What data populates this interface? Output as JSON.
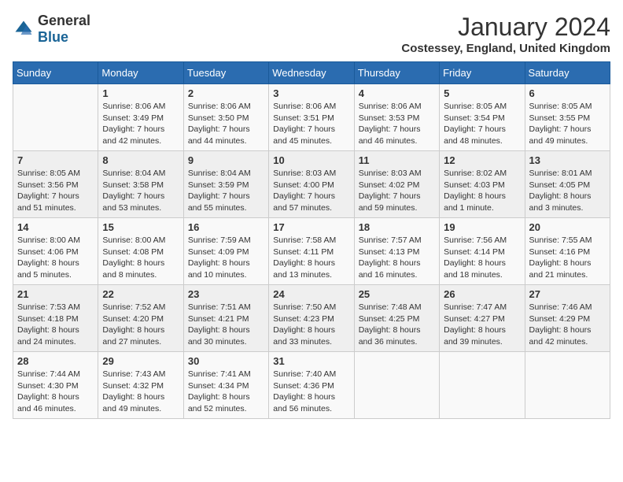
{
  "header": {
    "logo_general": "General",
    "logo_blue": "Blue",
    "title": "January 2024",
    "subtitle": "Costessey, England, United Kingdom"
  },
  "days_of_week": [
    "Sunday",
    "Monday",
    "Tuesday",
    "Wednesday",
    "Thursday",
    "Friday",
    "Saturday"
  ],
  "weeks": [
    [
      {
        "day": "",
        "sunrise": "",
        "sunset": "",
        "daylight": ""
      },
      {
        "day": "1",
        "sunrise": "Sunrise: 8:06 AM",
        "sunset": "Sunset: 3:49 PM",
        "daylight": "Daylight: 7 hours and 42 minutes."
      },
      {
        "day": "2",
        "sunrise": "Sunrise: 8:06 AM",
        "sunset": "Sunset: 3:50 PM",
        "daylight": "Daylight: 7 hours and 44 minutes."
      },
      {
        "day": "3",
        "sunrise": "Sunrise: 8:06 AM",
        "sunset": "Sunset: 3:51 PM",
        "daylight": "Daylight: 7 hours and 45 minutes."
      },
      {
        "day": "4",
        "sunrise": "Sunrise: 8:06 AM",
        "sunset": "Sunset: 3:53 PM",
        "daylight": "Daylight: 7 hours and 46 minutes."
      },
      {
        "day": "5",
        "sunrise": "Sunrise: 8:05 AM",
        "sunset": "Sunset: 3:54 PM",
        "daylight": "Daylight: 7 hours and 48 minutes."
      },
      {
        "day": "6",
        "sunrise": "Sunrise: 8:05 AM",
        "sunset": "Sunset: 3:55 PM",
        "daylight": "Daylight: 7 hours and 49 minutes."
      }
    ],
    [
      {
        "day": "7",
        "sunrise": "Sunrise: 8:05 AM",
        "sunset": "Sunset: 3:56 PM",
        "daylight": "Daylight: 7 hours and 51 minutes."
      },
      {
        "day": "8",
        "sunrise": "Sunrise: 8:04 AM",
        "sunset": "Sunset: 3:58 PM",
        "daylight": "Daylight: 7 hours and 53 minutes."
      },
      {
        "day": "9",
        "sunrise": "Sunrise: 8:04 AM",
        "sunset": "Sunset: 3:59 PM",
        "daylight": "Daylight: 7 hours and 55 minutes."
      },
      {
        "day": "10",
        "sunrise": "Sunrise: 8:03 AM",
        "sunset": "Sunset: 4:00 PM",
        "daylight": "Daylight: 7 hours and 57 minutes."
      },
      {
        "day": "11",
        "sunrise": "Sunrise: 8:03 AM",
        "sunset": "Sunset: 4:02 PM",
        "daylight": "Daylight: 7 hours and 59 minutes."
      },
      {
        "day": "12",
        "sunrise": "Sunrise: 8:02 AM",
        "sunset": "Sunset: 4:03 PM",
        "daylight": "Daylight: 8 hours and 1 minute."
      },
      {
        "day": "13",
        "sunrise": "Sunrise: 8:01 AM",
        "sunset": "Sunset: 4:05 PM",
        "daylight": "Daylight: 8 hours and 3 minutes."
      }
    ],
    [
      {
        "day": "14",
        "sunrise": "Sunrise: 8:00 AM",
        "sunset": "Sunset: 4:06 PM",
        "daylight": "Daylight: 8 hours and 5 minutes."
      },
      {
        "day": "15",
        "sunrise": "Sunrise: 8:00 AM",
        "sunset": "Sunset: 4:08 PM",
        "daylight": "Daylight: 8 hours and 8 minutes."
      },
      {
        "day": "16",
        "sunrise": "Sunrise: 7:59 AM",
        "sunset": "Sunset: 4:09 PM",
        "daylight": "Daylight: 8 hours and 10 minutes."
      },
      {
        "day": "17",
        "sunrise": "Sunrise: 7:58 AM",
        "sunset": "Sunset: 4:11 PM",
        "daylight": "Daylight: 8 hours and 13 minutes."
      },
      {
        "day": "18",
        "sunrise": "Sunrise: 7:57 AM",
        "sunset": "Sunset: 4:13 PM",
        "daylight": "Daylight: 8 hours and 16 minutes."
      },
      {
        "day": "19",
        "sunrise": "Sunrise: 7:56 AM",
        "sunset": "Sunset: 4:14 PM",
        "daylight": "Daylight: 8 hours and 18 minutes."
      },
      {
        "day": "20",
        "sunrise": "Sunrise: 7:55 AM",
        "sunset": "Sunset: 4:16 PM",
        "daylight": "Daylight: 8 hours and 21 minutes."
      }
    ],
    [
      {
        "day": "21",
        "sunrise": "Sunrise: 7:53 AM",
        "sunset": "Sunset: 4:18 PM",
        "daylight": "Daylight: 8 hours and 24 minutes."
      },
      {
        "day": "22",
        "sunrise": "Sunrise: 7:52 AM",
        "sunset": "Sunset: 4:20 PM",
        "daylight": "Daylight: 8 hours and 27 minutes."
      },
      {
        "day": "23",
        "sunrise": "Sunrise: 7:51 AM",
        "sunset": "Sunset: 4:21 PM",
        "daylight": "Daylight: 8 hours and 30 minutes."
      },
      {
        "day": "24",
        "sunrise": "Sunrise: 7:50 AM",
        "sunset": "Sunset: 4:23 PM",
        "daylight": "Daylight: 8 hours and 33 minutes."
      },
      {
        "day": "25",
        "sunrise": "Sunrise: 7:48 AM",
        "sunset": "Sunset: 4:25 PM",
        "daylight": "Daylight: 8 hours and 36 minutes."
      },
      {
        "day": "26",
        "sunrise": "Sunrise: 7:47 AM",
        "sunset": "Sunset: 4:27 PM",
        "daylight": "Daylight: 8 hours and 39 minutes."
      },
      {
        "day": "27",
        "sunrise": "Sunrise: 7:46 AM",
        "sunset": "Sunset: 4:29 PM",
        "daylight": "Daylight: 8 hours and 42 minutes."
      }
    ],
    [
      {
        "day": "28",
        "sunrise": "Sunrise: 7:44 AM",
        "sunset": "Sunset: 4:30 PM",
        "daylight": "Daylight: 8 hours and 46 minutes."
      },
      {
        "day": "29",
        "sunrise": "Sunrise: 7:43 AM",
        "sunset": "Sunset: 4:32 PM",
        "daylight": "Daylight: 8 hours and 49 minutes."
      },
      {
        "day": "30",
        "sunrise": "Sunrise: 7:41 AM",
        "sunset": "Sunset: 4:34 PM",
        "daylight": "Daylight: 8 hours and 52 minutes."
      },
      {
        "day": "31",
        "sunrise": "Sunrise: 7:40 AM",
        "sunset": "Sunset: 4:36 PM",
        "daylight": "Daylight: 8 hours and 56 minutes."
      },
      {
        "day": "",
        "sunrise": "",
        "sunset": "",
        "daylight": ""
      },
      {
        "day": "",
        "sunrise": "",
        "sunset": "",
        "daylight": ""
      },
      {
        "day": "",
        "sunrise": "",
        "sunset": "",
        "daylight": ""
      }
    ]
  ]
}
